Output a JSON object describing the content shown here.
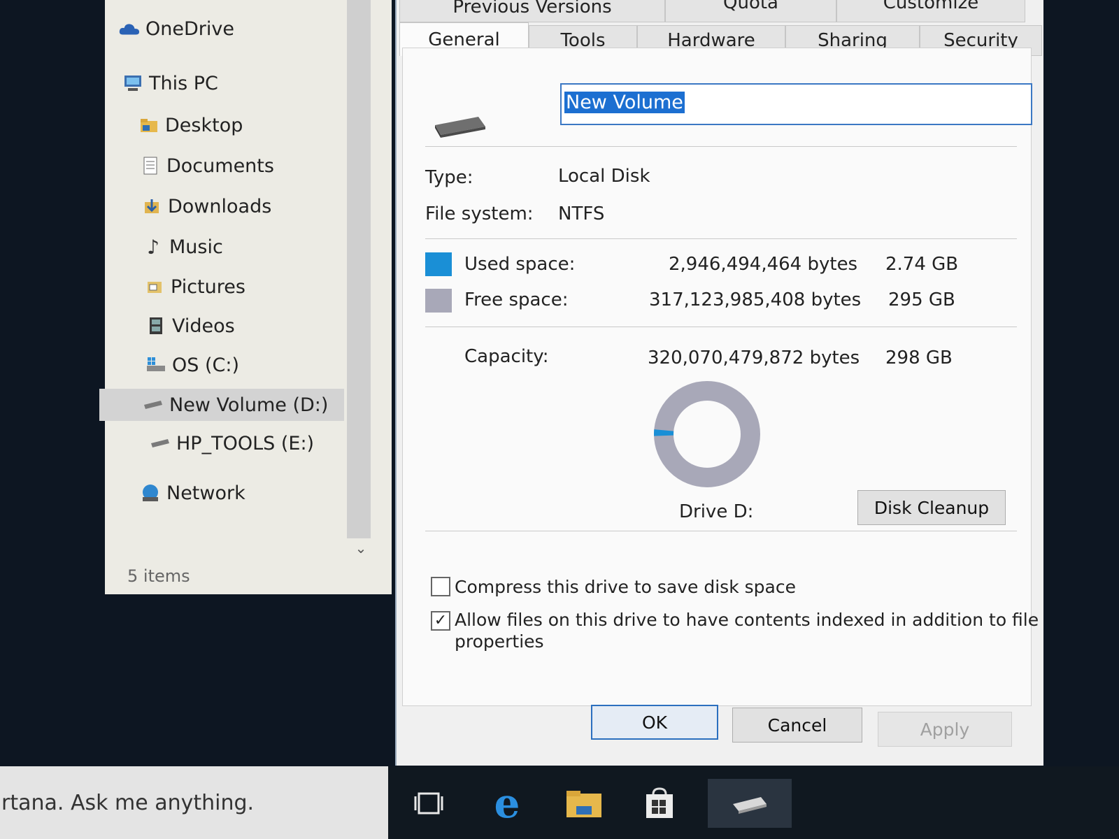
{
  "navigation": {
    "items": [
      {
        "label": "OneDrive",
        "icon": "cloud-icon"
      },
      {
        "label": "This PC",
        "icon": "computer-icon"
      },
      {
        "label": "Desktop",
        "icon": "folder-icon"
      },
      {
        "label": "Documents",
        "icon": "document-icon"
      },
      {
        "label": "Downloads",
        "icon": "download-icon"
      },
      {
        "label": "Music",
        "icon": "music-note-icon"
      },
      {
        "label": "Pictures",
        "icon": "picture-icon"
      },
      {
        "label": "Videos",
        "icon": "film-icon"
      },
      {
        "label": "OS (C:)",
        "icon": "windows-drive-icon"
      },
      {
        "label": "New Volume (D:)",
        "icon": "drive-icon",
        "selected": true
      },
      {
        "label": "HP_TOOLS (E:)",
        "icon": "drive-icon"
      },
      {
        "label": "Network",
        "icon": "network-icon"
      }
    ],
    "status": "5 items"
  },
  "dialog": {
    "tabs_back": [
      "Previous Versions",
      "Quota",
      "Customize"
    ],
    "tabs_front": [
      "General",
      "Tools",
      "Hardware",
      "Sharing",
      "Security"
    ],
    "active_tab": "General",
    "volume_name": "New Volume",
    "type_label": "Type:",
    "type_value": "Local Disk",
    "fs_label": "File system:",
    "fs_value": "NTFS",
    "used_label": "Used space:",
    "used_bytes": "2,946,494,464 bytes",
    "used_gb": "2.74 GB",
    "free_label": "Free space:",
    "free_bytes": "317,123,985,408 bytes",
    "free_gb": "295 GB",
    "capacity_label": "Capacity:",
    "capacity_bytes": "320,070,479,872 bytes",
    "capacity_gb": "298 GB",
    "used_fraction": 0.0092,
    "drive_label": "Drive D:",
    "disk_cleanup": "Disk Cleanup",
    "compress_label": "Compress this drive to save disk space",
    "compress_checked": false,
    "index_label_line1": "Allow files on this drive to have contents indexed in addition to file",
    "index_label_line2": "properties",
    "index_checked": true,
    "ok": "OK",
    "cancel": "Cancel",
    "apply": "Apply",
    "colors": {
      "used": "#1a8fd6",
      "free": "#a8a8b8"
    }
  },
  "taskbar": {
    "search_text": "rtana. Ask me anything.",
    "icons": [
      "task-view-icon",
      "edge-icon",
      "file-explorer-icon",
      "store-icon",
      "drive-icon"
    ]
  }
}
